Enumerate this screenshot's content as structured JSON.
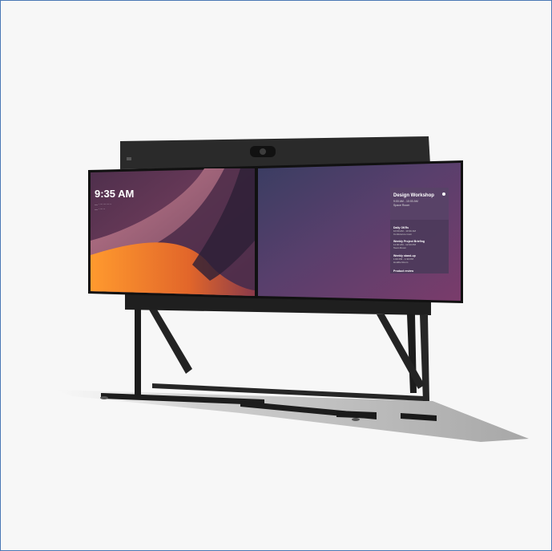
{
  "left_screen": {
    "time": "9:35 AM",
    "info_line1": "— ············",
    "info_line2": "— ······"
  },
  "right_screen": {
    "panel_title": "Design Workshop",
    "panel_time": "9:00 AM - 10:00 AM",
    "panel_room": "Space Room",
    "schedule": [
      {
        "title": "Daily OKRs",
        "line1": "10:00 AM - 10:30 AM",
        "line2": "Conference room"
      },
      {
        "title": "Weekly Project Briefing",
        "line1": "11:00 AM - 12:00 PM",
        "line2": "Team Room"
      },
      {
        "title": "Weekly stand-up",
        "line1": "1:00 PM - 1:30 PM",
        "line2": "Huddle Room"
      }
    ],
    "footer": "Product review"
  },
  "colors": {
    "frame_border": "#4a78b5",
    "device_body": "#222222",
    "screen_purple": "#6b3c6a",
    "accent_orange": "#f08a2c"
  }
}
